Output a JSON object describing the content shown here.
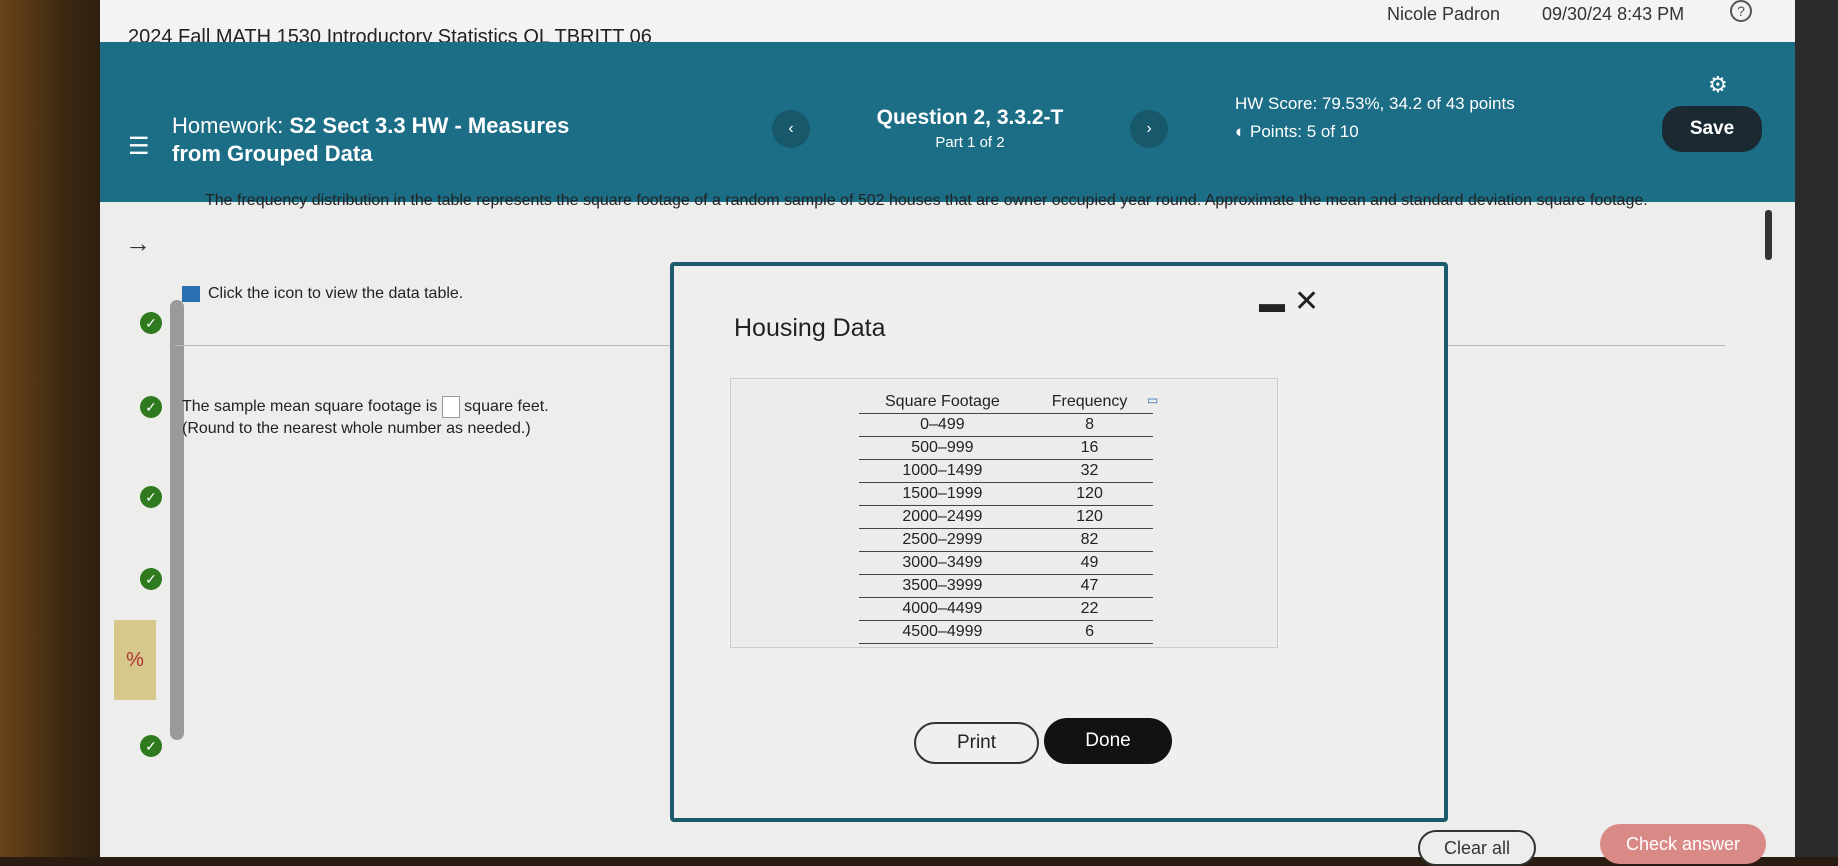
{
  "topbar": {
    "course": "2024 Fall MATH 1530 Introductory Statistics OL TBRITT 06",
    "user": "Nicole Padron",
    "datetime": "09/30/24 8:43 PM",
    "help": "?"
  },
  "header": {
    "hw_prefix": "Homework:",
    "hw_title": "S2 Sect 3.3 HW - Measures",
    "hw_title2": "from Grouped Data",
    "question": "Question 2, 3.3.2-T",
    "part": "Part 1 of 2",
    "hw_score": "HW Score: 79.53%, 34.2 of 43 points",
    "points": "Points: 5 of 10",
    "save": "Save",
    "prev": "‹",
    "next": "›"
  },
  "question": {
    "text": "The frequency distribution in the table represents the square footage of a random sample of 502 houses that are owner occupied year round. Approximate the mean and standard deviation square footage.",
    "icon_text": "Click the icon to view the data table.",
    "answer_prefix": "The sample mean square footage is",
    "answer_suffix": "square feet.",
    "round_note": "(Round to the nearest whole number as needed.)"
  },
  "modal": {
    "title": "Housing Data",
    "headers": [
      "Square Footage",
      "Frequency"
    ],
    "rows": [
      [
        "0–499",
        "8"
      ],
      [
        "500–999",
        "16"
      ],
      [
        "1000–1499",
        "32"
      ],
      [
        "1500–1999",
        "120"
      ],
      [
        "2000–2499",
        "120"
      ],
      [
        "2500–2999",
        "82"
      ],
      [
        "3000–3499",
        "49"
      ],
      [
        "3500–3999",
        "47"
      ],
      [
        "4000–4499",
        "22"
      ],
      [
        "4500–4999",
        "6"
      ]
    ],
    "print": "Print",
    "done": "Done"
  },
  "footer": {
    "clear_all": "Clear all",
    "check_answer": "Check answer"
  },
  "sidebar": {
    "status_icon": "%"
  },
  "colors": {
    "header": "#1b6e86",
    "done": "#121212",
    "check": "#d98a86",
    "correct": "#2f7a1f"
  }
}
